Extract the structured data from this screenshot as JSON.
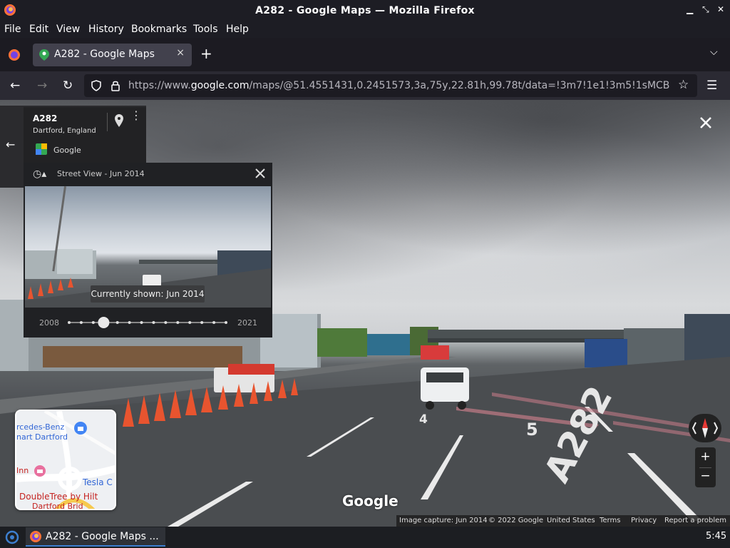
{
  "window": {
    "title": "A282 - Google Maps — Mozilla Firefox"
  },
  "menu": [
    "File",
    "Edit",
    "View",
    "History",
    "Bookmarks",
    "Tools",
    "Help"
  ],
  "tab": {
    "label": "A282 - Google Maps",
    "close": "×",
    "new": "+"
  },
  "address": {
    "prefix": "https://www.",
    "domain": "google.com",
    "rest": "/maps/@51.4551431,0.2451573,3a,75y,22.81h,99.78t/data=!3m7!1e1!3m5!1sMCB"
  },
  "place": {
    "name": "A282",
    "location": "Dartford, England",
    "source": "Google"
  },
  "street_view": {
    "header": "Street View - Jun 2014",
    "tooltip": "Currently shown: Jun 2014",
    "year_start": "2008",
    "year_end": "2021",
    "timeline_position": 0.22
  },
  "minimap": {
    "labels": [
      "rcedes-Benz",
      "nart Dartford",
      "Inn",
      "Tesla C",
      "DoubleTree by Hilt",
      "Dartford Brid"
    ]
  },
  "road_markings": {
    "lane4": "4",
    "lane5": "5",
    "road": "A282"
  },
  "watermark": "Google",
  "attribution": {
    "capture": "Image capture: Jun 2014",
    "copyright": "© 2022 Google",
    "country": "United States",
    "terms": "Terms",
    "privacy": "Privacy",
    "report": "Report a problem"
  },
  "zoom": {
    "in": "+",
    "out": "−"
  },
  "taskbar": {
    "app": "A282 - Google Maps ...",
    "clock": "5:45"
  },
  "colors": {
    "accent": "#3d7fcf",
    "panel": "#202124",
    "cone": "#e8542f"
  }
}
